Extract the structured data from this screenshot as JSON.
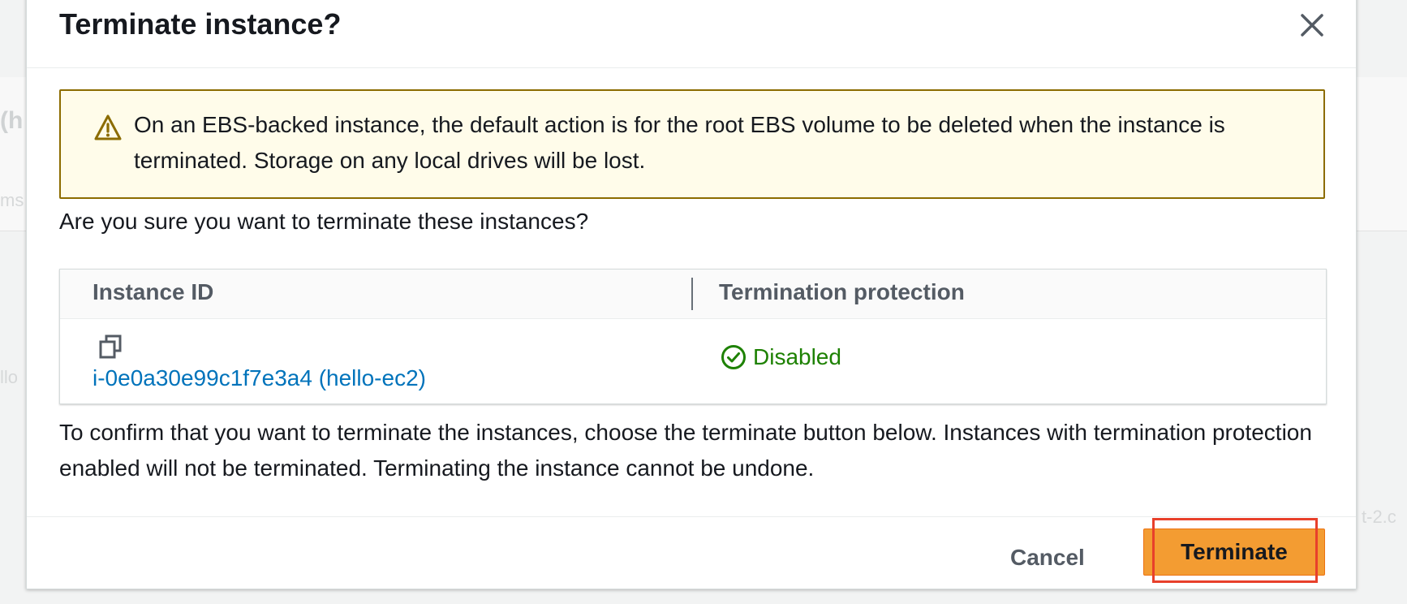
{
  "background": {
    "fragment_heading": "(h",
    "fragment_label": "ms",
    "fragment_row": "llo",
    "fragment_right": "t-2.c"
  },
  "modal": {
    "title": "Terminate instance?",
    "close_icon": "close-icon",
    "warning": {
      "icon": "warning-triangle-icon",
      "text": "On an EBS-backed instance, the default action is for the root EBS volume to be deleted when the instance is terminated. Storage on any local drives will be lost."
    },
    "question": "Are you sure you want to terminate these instances?",
    "table": {
      "columns": [
        "Instance ID",
        "Termination protection"
      ],
      "rows": [
        {
          "instance": "i-0e0a30e99c1f7e3a4 (hello-ec2)",
          "protection": "Disabled",
          "copy_icon": "copy-icon",
          "status_icon": "check-circle-icon"
        }
      ]
    },
    "confirm_text": "To confirm that you want to terminate the instances, choose the terminate button below. Instances with termination protection enabled will not be terminated. Terminating the instance cannot be undone.",
    "footer": {
      "cancel_label": "Cancel",
      "terminate_label": "Terminate"
    }
  },
  "colors": {
    "primary_button": "#f39c32",
    "link": "#0073bb",
    "success": "#1d8102",
    "warning_border": "#8c6c00",
    "highlight": "#e8402b"
  }
}
